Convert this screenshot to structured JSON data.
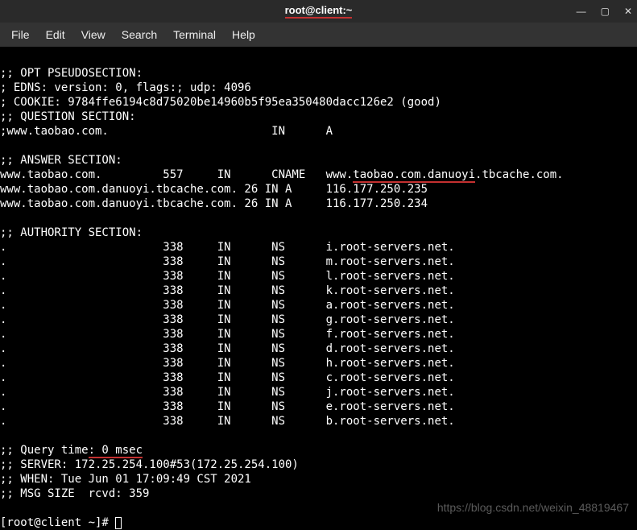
{
  "window": {
    "title": "root@client:~",
    "minimize": "—",
    "maximize": "▢",
    "close": "✕"
  },
  "menu": {
    "file": "File",
    "edit": "Edit",
    "view": "View",
    "search": "Search",
    "terminal": "Terminal",
    "help": "Help"
  },
  "term": {
    "l1": ";; OPT PSEUDOSECTION:",
    "l2": "; EDNS: version: 0, flags:; udp: 4096",
    "l3": "; COOKIE: 9784ffe6194c8d75020be14960b5f95ea350480dacc126e2 (good)",
    "l4": ";; QUESTION SECTION:",
    "l5": ";www.taobao.com.                        IN      A",
    "l6": "",
    "l7": ";; ANSWER SECTION:",
    "l8a": "www.taobao.com.         557     IN      CNAME   www.",
    "l8b": "taobao.com.danuoyi",
    "l8c": ".tbcache.com.",
    "l9": "www.taobao.com.danuoyi.tbcache.com. 26 IN A     116.177.250.235",
    "l10": "www.taobao.com.danuoyi.tbcache.com. 26 IN A     116.177.250.234",
    "l11": "",
    "l12": ";; AUTHORITY SECTION:",
    "l13": ".                       338     IN      NS      i.root-servers.net.",
    "l14": ".                       338     IN      NS      m.root-servers.net.",
    "l15": ".                       338     IN      NS      l.root-servers.net.",
    "l16": ".                       338     IN      NS      k.root-servers.net.",
    "l17": ".                       338     IN      NS      a.root-servers.net.",
    "l18": ".                       338     IN      NS      g.root-servers.net.",
    "l19": ".                       338     IN      NS      f.root-servers.net.",
    "l20": ".                       338     IN      NS      d.root-servers.net.",
    "l21": ".                       338     IN      NS      h.root-servers.net.",
    "l22": ".                       338     IN      NS      c.root-servers.net.",
    "l23": ".                       338     IN      NS      j.root-servers.net.",
    "l24": ".                       338     IN      NS      e.root-servers.net.",
    "l25": ".                       338     IN      NS      b.root-servers.net.",
    "l26": "",
    "l27a": ";; Query time",
    "l27b": ": 0 msec",
    "l28": ";; SERVER: 172.25.254.100#53(172.25.254.100)",
    "l29": ";; WHEN: Tue Jun 01 17:09:49 CST 2021",
    "l30": ";; MSG SIZE  rcvd: 359",
    "l31": "",
    "prompt": "[root@client ~]# "
  },
  "watermark": "https://blog.csdn.net/weixin_48819467"
}
